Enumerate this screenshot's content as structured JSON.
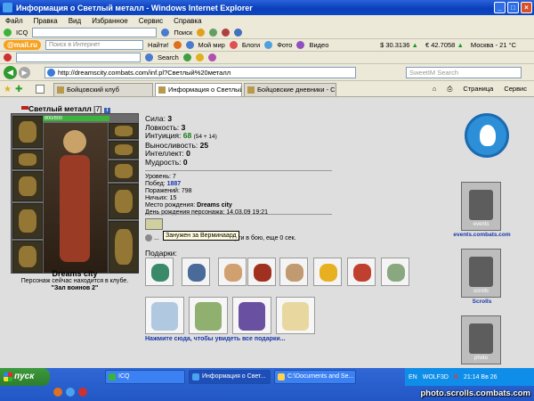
{
  "window": {
    "title": "Информация о Светлый металл - Windows Internet Explorer"
  },
  "menu": [
    "Файл",
    "Правка",
    "Вид",
    "Избранное",
    "Сервис",
    "Справка"
  ],
  "toolbar1": {
    "icq": "ICQ",
    "search": "Поиск"
  },
  "toolbar2": {
    "mail_logo": "@mail.ru",
    "search_placeholder": "Поиск в Интернет",
    "find": "Найти!",
    "my_world": "Мой мир",
    "blogs": "Блоги",
    "photo": "Фото",
    "video": "Видео",
    "usd": "$ 30.3136",
    "eur": "€ 42.7058",
    "weather": "Москва - 21 °C"
  },
  "toolbar3": {
    "search": "Search"
  },
  "address": {
    "url": "http://dreamscity.combats.com/inf.pl?Светлый%20металл",
    "search_placeholder": "SweetIM Search"
  },
  "tabs": [
    "Бойцовский клуб",
    "Информация о Светлый ...",
    "Бойцовские дневники - Свет..."
  ],
  "commands": {
    "page": "Страница",
    "service": "Сервис"
  },
  "character": {
    "name": "Светлый металл",
    "level": "[7]",
    "hp": "800/800",
    "city": "Dreams city",
    "status_note": "Персонаж сейчас находится в клубе.",
    "club": "\"Зал воинов 2\""
  },
  "stats": {
    "strength_label": "Сила:",
    "strength": "3",
    "agility_label": "Ловкость:",
    "agility": "3",
    "intuition_label": "Интуиция:",
    "intuition": "68",
    "intuition_bonus": "(54 + 14)",
    "endurance_label": "Выносливость:",
    "endurance": "25",
    "intellect_label": "Интеллект:",
    "intellect": "0",
    "wisdom_label": "Мудрость:",
    "wisdom": "0"
  },
  "record": {
    "level_label": "Уровень:",
    "level": "7",
    "wins_label": "Побед:",
    "wins": "1887",
    "losses_label": "Поражений:",
    "losses": "798",
    "draws_label": "Ничьих:",
    "draws": "15",
    "birthplace_label": "Место рождения:",
    "birthplace": "Dreams city",
    "birthday_label": "День рождения персонажа:",
    "birthday": "14.03.09 19:21"
  },
  "effects": {
    "tooltip": "Занужен за Верминаард",
    "death_text_left": "...",
    "death_text_right": "нерти в бою, еще 0 сек."
  },
  "gifts": {
    "label": "Подарки:",
    "more_link": "Нажмите сюда, чтобы увидеть все подарки..."
  },
  "right_panel": {
    "events_label": "events",
    "events_link": "events.combats.com",
    "scrolls_label": "scrolls",
    "scrolls_link": "Scrolls",
    "photo_label": "photo"
  },
  "taskbar": {
    "start": "пуск",
    "tasks": [
      "ICQ",
      "Информация о Свет...",
      "C:\\Documents and Se..."
    ],
    "lang": "EN",
    "tray_text": "WOLF3D",
    "clock": "21:14 Вв 26"
  },
  "watermark": "photo.scrolls.combats.com"
}
